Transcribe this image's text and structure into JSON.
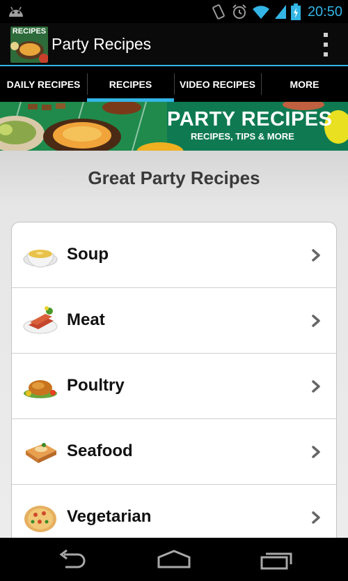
{
  "status_bar": {
    "time": "20:50",
    "icons": [
      "android-icon",
      "vibrate-icon",
      "alarm-icon",
      "wifi-icon",
      "signal-icon",
      "battery-charging-icon"
    ]
  },
  "action_bar": {
    "app_icon_label": "RECIPES",
    "title": "Party Recipes",
    "overflow_icon": "overflow-menu-icon"
  },
  "tabs": [
    {
      "label": "DAILY RECIPES",
      "active": false
    },
    {
      "label": "RECIPES",
      "active": true
    },
    {
      "label": "VIDEO RECIPES",
      "active": false
    },
    {
      "label": "MORE",
      "active": false
    }
  ],
  "banner": {
    "title": "PARTY RECIPES",
    "subtitle": "RECIPES, TIPS & MORE"
  },
  "main": {
    "section_title": "Great Party Recipes",
    "items": [
      {
        "label": "Soup",
        "icon": "soup-bowl-icon"
      },
      {
        "label": "Meat",
        "icon": "meat-plate-icon"
      },
      {
        "label": "Poultry",
        "icon": "roast-chicken-icon"
      },
      {
        "label": "Seafood",
        "icon": "seafood-dish-icon"
      },
      {
        "label": "Vegetarian",
        "icon": "pizza-icon"
      }
    ]
  },
  "nav_bar": {
    "buttons": [
      "back-icon",
      "home-icon",
      "recent-apps-icon"
    ]
  },
  "colors": {
    "accent": "#33b5e5",
    "banner_green": "#0f7a52",
    "chevron": "#666666"
  }
}
